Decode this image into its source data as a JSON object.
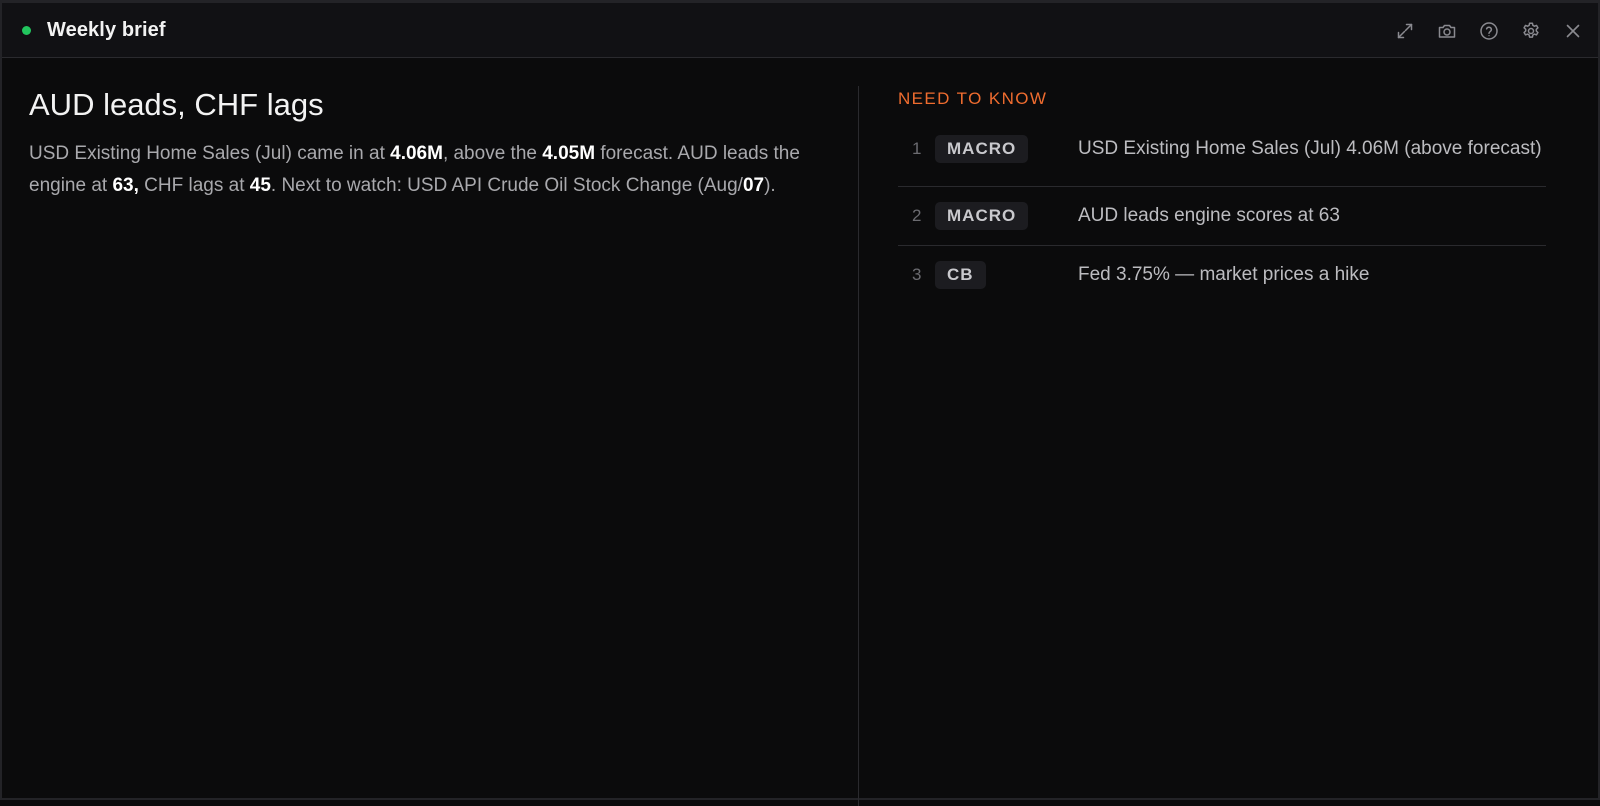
{
  "window": {
    "title": "Weekly brief",
    "status_color": "#22c55e"
  },
  "toolbar": {
    "icons": [
      "expand-icon",
      "camera-icon",
      "help-icon",
      "gear-icon",
      "close-icon"
    ]
  },
  "brief": {
    "headline": "AUD leads, CHF lags",
    "summary": {
      "p1": "USD Existing Home Sales (Jul) came in at ",
      "v1": "4.06M",
      "p2": ", above the ",
      "v2": "4.05M",
      "p3": " forecast. AUD leads the engine at ",
      "v3": "63,",
      "p4": " CHF lags at ",
      "v4": "45",
      "p5": ". Next to watch: USD API Crude Oil Stock Change (Aug/",
      "v5": "07",
      "p6": ")."
    }
  },
  "need_to_know": {
    "title": "NEED TO KNOW",
    "accent_color": "#ef6c2f",
    "items": [
      {
        "number": "1",
        "tag": "MACRO",
        "text": "USD Existing Home Sales (Jul) 4.06M (above forecast)"
      },
      {
        "number": "2",
        "tag": "MACRO",
        "text": "AUD leads engine scores at 63"
      },
      {
        "number": "3",
        "tag": "CB",
        "text": "Fed 3.75% — market prices a hike"
      }
    ]
  }
}
